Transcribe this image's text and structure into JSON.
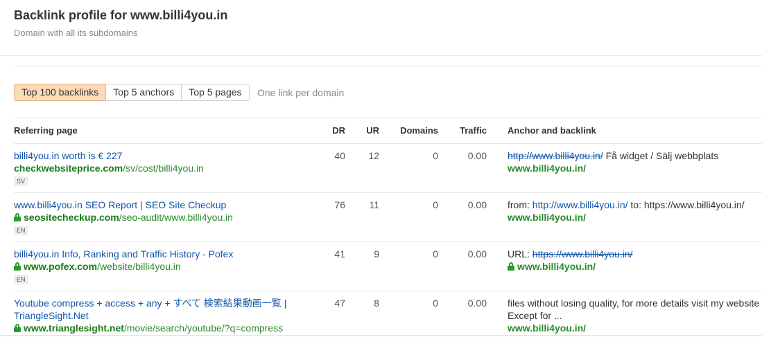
{
  "header": {
    "title": "Backlink profile for www.billi4you.in",
    "subtitle": "Domain with all its subdomains"
  },
  "tabs": [
    {
      "label": "Top 100 backlinks",
      "active": true
    },
    {
      "label": "Top 5 anchors",
      "active": false
    },
    {
      "label": "Top 5 pages",
      "active": false
    }
  ],
  "one_link_label": "One link per domain",
  "columns": {
    "referring_page": "Referring page",
    "dr": "DR",
    "ur": "UR",
    "domains": "Domains",
    "traffic": "Traffic",
    "anchor": "Anchor and backlink"
  },
  "rows": [
    {
      "title": "billi4you.in worth is € 227",
      "url_domain": "checkwebsiteprice.com",
      "url_path": "/sv/cost/billi4you.in",
      "secure": false,
      "lang": "SV",
      "dr": "40",
      "ur": "12",
      "domains": "0",
      "traffic": "0.00",
      "anchor_struck": "http://www.billi4you.in/",
      "anchor_text": " Få widget / Sälj webbplats",
      "backlink": "www.billi4you.in/",
      "backlink_secure": false
    },
    {
      "title": "www.billi4you.in SEO Report | SEO Site Checkup",
      "url_domain": "seositecheckup.com",
      "url_path": "/seo-audit/www.billi4you.in",
      "secure": true,
      "lang": "EN",
      "dr": "76",
      "ur": "11",
      "domains": "0",
      "traffic": "0.00",
      "anchor_prefix": "from: ",
      "anchor_link": "http://www.billi4you.in/",
      "anchor_suffix": " to: https://www.billi4you.in/",
      "backlink": "www.billi4you.in/",
      "backlink_secure": false
    },
    {
      "title": "billi4you.in Info, Ranking and Traffic History - Pofex",
      "url_domain": "www.pofex.com",
      "url_path": "/website/billi4you.in",
      "secure": true,
      "lang": "EN",
      "dr": "41",
      "ur": "9",
      "domains": "0",
      "traffic": "0.00",
      "anchor_prefix": "URL: ",
      "anchor_struck": "https://www.billi4you.in/",
      "backlink": "www.billi4you.in/",
      "backlink_secure": true
    },
    {
      "title": "Youtube compress + access + any + すべて 検索結果動画一覧 | TriangleSight.Net",
      "url_domain": "www.trianglesight.net",
      "url_path": "/movie/search/youtube/?q=compress",
      "secure": true,
      "lang": "",
      "dr": "47",
      "ur": "8",
      "domains": "0",
      "traffic": "0.00",
      "anchor_text": "files without losing quality, for more details visit my website Except for ...",
      "backlink": "www.billi4you.in/",
      "backlink_secure": false
    }
  ],
  "colors": {
    "link_blue": "#1155a8",
    "url_green": "#2a8a2a",
    "active_tab_bg": "#fcd9b8"
  }
}
